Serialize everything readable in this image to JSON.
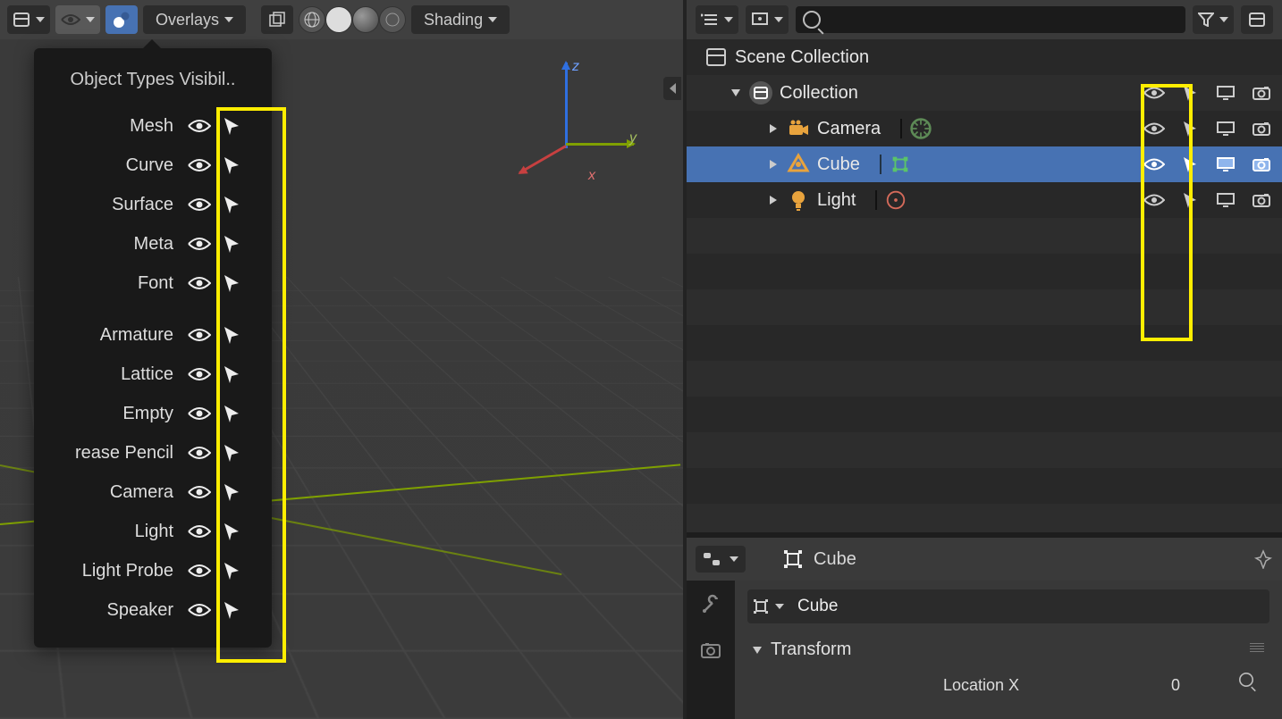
{
  "viewport_header": {
    "overlays_label": "Overlays",
    "shading_label": "Shading"
  },
  "axis_labels": {
    "x": "x",
    "y": "y",
    "z": "z"
  },
  "popover": {
    "title": "Object Types Visibil..",
    "group1": [
      "Mesh",
      "Curve",
      "Surface",
      "Meta",
      "Font"
    ],
    "group2": [
      "Armature",
      "Lattice",
      "Empty",
      "rease Pencil",
      "Camera",
      "Light",
      "Light Probe",
      "Speaker"
    ]
  },
  "outliner": {
    "root_label": "Scene Collection",
    "collection_label": "Collection",
    "items": [
      {
        "name": "Camera",
        "icon": "camera",
        "selected": false
      },
      {
        "name": "Cube",
        "icon": "mesh",
        "selected": true
      },
      {
        "name": "Light",
        "icon": "light",
        "selected": false
      }
    ]
  },
  "properties": {
    "header_object_name": "Cube",
    "name_field_value": "Cube",
    "transform_panel_label": "Transform",
    "partial_label": "Location X",
    "partial_value": "0"
  }
}
